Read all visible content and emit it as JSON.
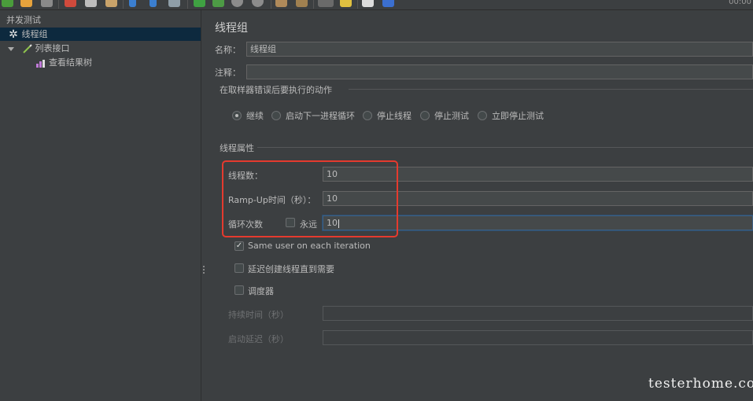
{
  "toolbar": {
    "icons": [
      "templates-icon",
      "open-icon",
      "save-icon",
      "cut-icon",
      "copy-icon",
      "paste-icon",
      "expand-icon",
      "collapse-icon",
      "toggle-icon",
      "start-icon",
      "start-no-pause-icon",
      "stop-icon",
      "shutdown-icon",
      "clear-icon",
      "clear-all-icon",
      "search-icon",
      "reset-search-icon",
      "function-helper-icon",
      "help-icon"
    ],
    "time": "00:00"
  },
  "tree": {
    "root": "并发测试",
    "thread_group": "线程组",
    "sampler": "列表接口",
    "listener": "查看结果树"
  },
  "panel": {
    "title": "线程组",
    "name_label": "名称：",
    "name_value": "线程组",
    "comment_label": "注释：",
    "comment_value": "",
    "error_action_title": "在取样器错误后要执行的动作",
    "error_actions": [
      "继续",
      "启动下一进程循环",
      "停止线程",
      "停止测试",
      "立即停止测试"
    ],
    "thread_props_title": "线程属性",
    "threads_label": "线程数：",
    "threads_value": "10",
    "rampup_label": "Ramp-Up时间（秒）：",
    "rampup_value": "10",
    "loop_label": "循环次数",
    "forever_label": "永远",
    "loop_value": "10",
    "same_user_label": "Same user on each iteration",
    "delay_label": "延迟创建线程直到需要",
    "scheduler_label": "调度器",
    "duration_label": "持续时间（秒）",
    "startup_delay_label": "启动延迟（秒）"
  },
  "watermark": "testerhome.com",
  "colors": {
    "highlight": "#e53a2e",
    "selection": "#0d293e",
    "background": "#3c3f41"
  }
}
